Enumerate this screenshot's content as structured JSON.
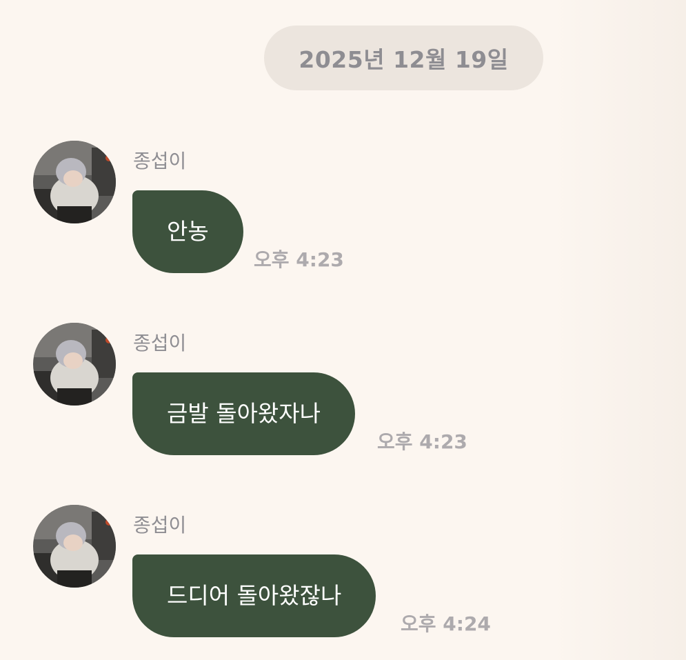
{
  "chat": {
    "date_divider": "2025년 12월 19일",
    "messages": [
      {
        "sender": "종섭이",
        "text": "안농",
        "time": "오후 4:23"
      },
      {
        "sender": "종섭이",
        "text": "금발 돌아왔자나",
        "time": "오후 4:23"
      },
      {
        "sender": "종섭이",
        "text": "드디어 돌아왔잖나",
        "time": "오후 4:24"
      }
    ]
  },
  "colors": {
    "background": "#fcf6f0",
    "date_pill": "#ece5de",
    "bubble": "#3d523d",
    "bubble_text": "#ffffff",
    "meta_text": "#8e8d92"
  },
  "icons": {
    "avatar": "profile-photo"
  }
}
